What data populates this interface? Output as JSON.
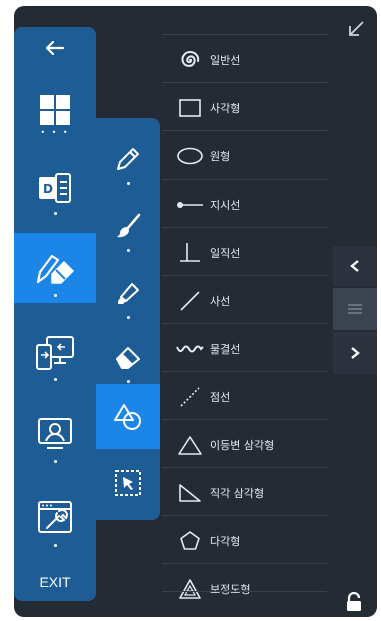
{
  "main_bar": {
    "items": [
      {
        "name": "back",
        "icon": "back-arrow-icon"
      },
      {
        "name": "windows",
        "icon": "windows-logo-icon"
      },
      {
        "name": "docs",
        "icon": "docs-app-icon"
      },
      {
        "name": "pen-eraser",
        "icon": "pen-eraser-icon",
        "active": true
      },
      {
        "name": "screen-share",
        "icon": "screen-share-icon"
      },
      {
        "name": "presenter",
        "icon": "presenter-icon"
      },
      {
        "name": "settings",
        "icon": "settings-wrench-icon"
      }
    ],
    "exit_label": "EXIT"
  },
  "sub_bar": {
    "items": [
      {
        "name": "pen",
        "icon": "pen-icon"
      },
      {
        "name": "brush",
        "icon": "brush-icon"
      },
      {
        "name": "highlighter",
        "icon": "highlighter-icon"
      },
      {
        "name": "eraser",
        "icon": "eraser-icon"
      },
      {
        "name": "shapes",
        "icon": "shapes-icon",
        "active": true
      },
      {
        "name": "select",
        "icon": "select-area-icon"
      }
    ]
  },
  "shapes": {
    "items": [
      {
        "label": "일반선",
        "icon": "spiral-icon"
      },
      {
        "label": "사각형",
        "icon": "rectangle-icon"
      },
      {
        "label": "원형",
        "icon": "ellipse-icon"
      },
      {
        "label": "지시선",
        "icon": "pointer-line-icon"
      },
      {
        "label": "일직선",
        "icon": "perpendicular-icon"
      },
      {
        "label": "사선",
        "icon": "diagonal-line-icon"
      },
      {
        "label": "물결선",
        "icon": "wave-line-icon"
      },
      {
        "label": "점선",
        "icon": "dotted-line-icon"
      },
      {
        "label": "이등변 삼각형",
        "icon": "isosceles-triangle-icon"
      },
      {
        "label": "직각 삼각형",
        "icon": "right-triangle-icon"
      },
      {
        "label": "다각형",
        "icon": "polygon-icon"
      },
      {
        "label": "보정도형",
        "icon": "shape-correction-icon"
      }
    ]
  },
  "colors": {
    "panel_bg": "#252b35",
    "bar_bg": "#1e5c96",
    "active_bg": "#1c86e8",
    "text": "#e6e9ee"
  }
}
